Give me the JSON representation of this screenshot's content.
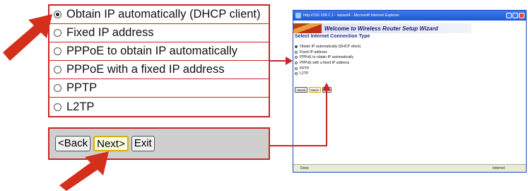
{
  "zoom_options": [
    {
      "label": "Obtain IP automatically (DHCP client)",
      "selected": true
    },
    {
      "label": "Fixed IP address",
      "selected": false
    },
    {
      "label": "PPPoE to obtain IP automatically",
      "selected": false
    },
    {
      "label": "PPPoE with a fixed IP address",
      "selected": false
    },
    {
      "label": "PPTP",
      "selected": false
    },
    {
      "label": "L2TP",
      "selected": false
    }
  ],
  "buttons": {
    "back": "<Back",
    "next": "Next>",
    "exit": "Exit"
  },
  "browser": {
    "title": "http://192.168.1.1 - wizard4 - Microsoft Internet Explorer",
    "banner": "Welcome to Wireless Router Setup Wizard",
    "section_title": "Select Internet Connection Type",
    "status_left": "Done",
    "status_right": "Internet"
  },
  "colors": {
    "accent_red": "#c62828",
    "title_blue": "#1e55d4",
    "heading_blue": "#1d2d8c"
  }
}
